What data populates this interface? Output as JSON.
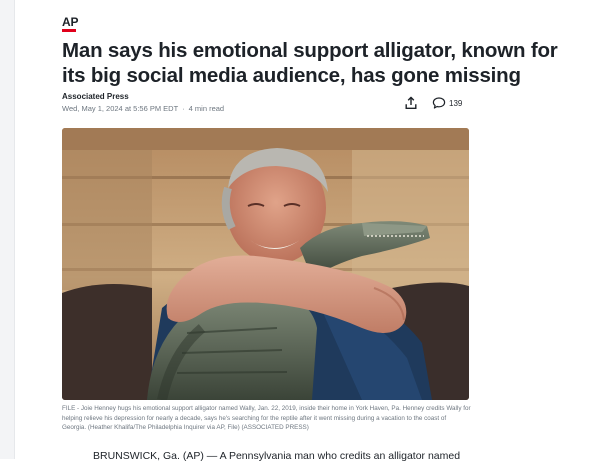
{
  "source": {
    "name": "AP",
    "accent_color": "#e0001b"
  },
  "article": {
    "headline": "Man says his emotional support alligator, known for its big social media audience, has gone missing",
    "publisher": "Associated Press",
    "date": "Wed, May 1, 2024 at 5:56 PM EDT",
    "read_time": "4 min read",
    "comment_count": "139",
    "photo_caption": "FILE - Joie Henney hugs his emotional support alligator named Wally, Jan. 22, 2019, inside their home in York Haven, Pa. Henney credits Wally for helping relieve his depression for nearly a decade, says he's searching for the reptile after it went missing during a vacation to the coast of Georgia. (Heather Khalifa/The Philadelphia Inquirer via AP, File) (ASSOCIATED PRESS)",
    "body_first_line": "BRUNSWICK, Ga. (AP) — A Pennsylvania man who credits an alligator named"
  },
  "icons": {
    "share": "share-icon",
    "comment": "comment-icon"
  }
}
